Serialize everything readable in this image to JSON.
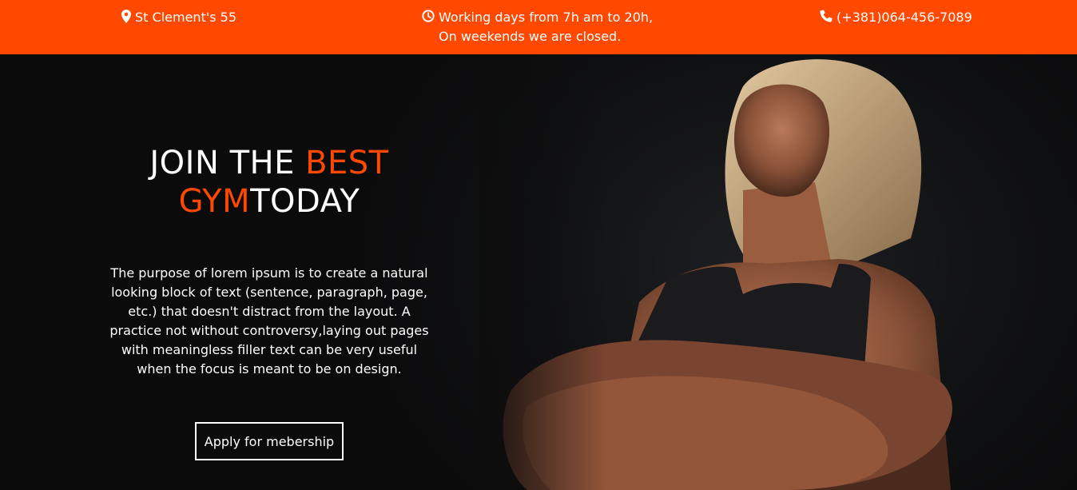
{
  "colors": {
    "accent": "#ff4800",
    "hero_background": "#0d0d0e",
    "text": "#ffffff"
  },
  "topbar": {
    "address": {
      "icon": "map-marker-icon",
      "text": "St Clement's 55"
    },
    "hours": {
      "icon": "clock-icon",
      "line1": "Working days from 7h am to 20h,",
      "line2": "On weekends we are closed."
    },
    "phone": {
      "icon": "phone-icon",
      "text": "(+381)064-456-7089"
    }
  },
  "hero": {
    "title": {
      "part1": "JOIN THE ",
      "part2_accent": "BEST",
      "part3_accent": "GYM",
      "part4": "TODAY"
    },
    "description": "The purpose of lorem ipsum is to create a natural looking block of text (sentence, paragraph, page, etc.) that doesn't distract from the layout. A practice not without controversy,laying out pages with meaningless filler text can be very useful when the focus is meant to be on design.",
    "cta_label": "Apply for mebership",
    "image_subject": "athlete-woman-arms-crossed"
  }
}
